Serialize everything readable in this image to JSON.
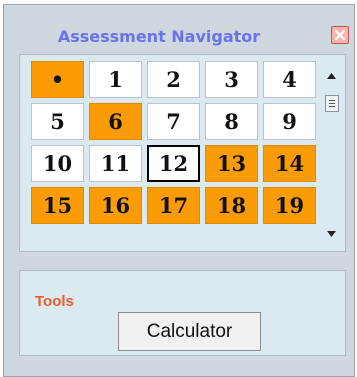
{
  "window": {
    "title": "Assessment Navigator",
    "close_icon": "close-icon"
  },
  "colors": {
    "answered": "#fb9b05",
    "unanswered": "#ffffff",
    "title": "#6a72f0",
    "tools_label": "#ef5a2b",
    "close_button": "#f3b5ac"
  },
  "navigator": {
    "items": [
      {
        "label": "•",
        "state": "answered",
        "name": "question-cell-current-marker"
      },
      {
        "label": "1",
        "state": "unanswered"
      },
      {
        "label": "2",
        "state": "unanswered"
      },
      {
        "label": "3",
        "state": "unanswered"
      },
      {
        "label": "4",
        "state": "unanswered"
      },
      {
        "label": "5",
        "state": "unanswered"
      },
      {
        "label": "6",
        "state": "answered"
      },
      {
        "label": "7",
        "state": "unanswered"
      },
      {
        "label": "8",
        "state": "unanswered"
      },
      {
        "label": "9",
        "state": "unanswered"
      },
      {
        "label": "10",
        "state": "unanswered"
      },
      {
        "label": "11",
        "state": "unanswered"
      },
      {
        "label": "12",
        "state": "current"
      },
      {
        "label": "13",
        "state": "answered"
      },
      {
        "label": "14",
        "state": "answered"
      },
      {
        "label": "15",
        "state": "answered"
      },
      {
        "label": "16",
        "state": "answered"
      },
      {
        "label": "17",
        "state": "answered"
      },
      {
        "label": "18",
        "state": "answered"
      },
      {
        "label": "19",
        "state": "answered"
      }
    ]
  },
  "tools": {
    "label": "Tools",
    "calculator_label": "Calculator"
  }
}
